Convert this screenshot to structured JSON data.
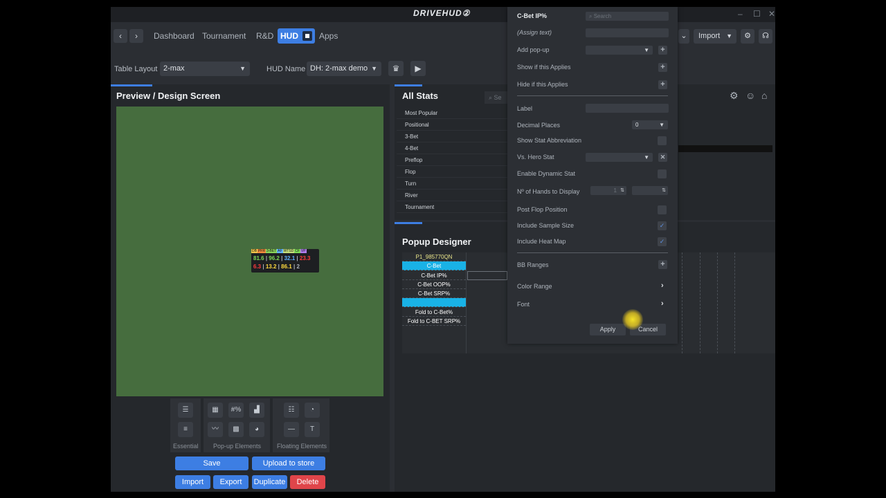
{
  "app": {
    "logo": "DRIVEHUD②",
    "window_controls": [
      "–",
      "☐",
      "✕"
    ]
  },
  "nav": {
    "back": "‹",
    "forward": "›",
    "links": [
      "Dashboard",
      "Tournament",
      "R&D"
    ],
    "active": "HUD",
    "apps": "Apps",
    "import_label": "Import"
  },
  "layout": {
    "table_layout_label": "Table Layout",
    "table_layout_value": "2-max",
    "hud_name_label": "HUD Name",
    "hud_name_value": "DH: 2-max demo"
  },
  "preview": {
    "title": "Preview / Design Screen",
    "hud": {
      "tags": [
        "DB",
        "PFR",
        "3-BET",
        "AF",
        "WTSD",
        "CF",
        "VP"
      ],
      "row1": [
        "81.6",
        "96.2",
        "32.1",
        "23.3"
      ],
      "row1_colors": [
        "#7ed957",
        "#7ed957",
        "#5fb3ff",
        "#ff3b3b"
      ],
      "row2": [
        "6.3",
        "13.2",
        "86.1",
        "2"
      ],
      "row2_colors": [
        "#ff3b3b",
        "#ffd93d",
        "#ffd93d",
        "#aeb4bc"
      ]
    },
    "tool_groups": [
      "Essential",
      "Pop-up Elements",
      "Floating Elements"
    ],
    "buttons": {
      "save": "Save",
      "upload": "Upload to store",
      "import": "Import",
      "export": "Export",
      "duplicate": "Duplicate",
      "delete": "Delete"
    }
  },
  "stats": {
    "title": "All Stats",
    "search_placeholder": "Se",
    "categories": [
      "Most Popular",
      "Positional",
      "3-Bet",
      "4-Bet",
      "Preflop",
      "Flop",
      "Turn",
      "River",
      "Tournament"
    ]
  },
  "popup_designer": {
    "title": "Popup Designer",
    "rows": [
      "P1_985770QN",
      "C-Bet",
      "C-Bet IP%",
      "C-Bet OOP%",
      "C-Bet SRP%",
      "",
      "Fold to C-Bet%",
      "Fold to C-BET SRP%"
    ],
    "selected_rows": [
      1,
      5
    ]
  },
  "dialog": {
    "title": "C-Bet IP%",
    "search_placeholder": "Search",
    "assign_text": "(Assign text)",
    "add_popup": "Add pop-up",
    "show_if": "Show if this Applies",
    "hide_if": "Hide if this Applies",
    "label": "Label",
    "decimal_places": "Decimal Places",
    "decimal_value": "0",
    "show_abbrev": "Show Stat Abbreviation",
    "vs_hero": "Vs. Hero Stat",
    "enable_dynamic": "Enable Dynamic Stat",
    "hands_display": "Nº of Hands to Display",
    "hands_value": "1",
    "post_flop": "Post Flop Position",
    "include_sample": "Include Sample Size",
    "include_heat": "Include Heat Map",
    "include_sample_checked": true,
    "include_heat_checked": true,
    "bb_ranges": "BB Ranges",
    "color_range": "Color Range",
    "font": "Font",
    "apply": "Apply",
    "cancel": "Cancel"
  }
}
